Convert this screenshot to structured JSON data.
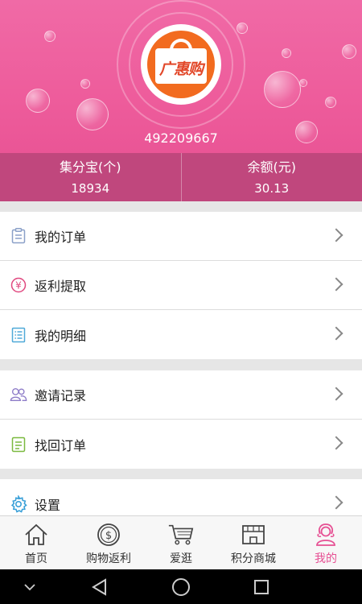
{
  "header": {
    "logo_text": "广惠购",
    "user_id": "492209667"
  },
  "stats": [
    {
      "label": "集分宝(个)",
      "value": "18934"
    },
    {
      "label": "余额(元)",
      "value": "30.13"
    }
  ],
  "menu_groups": [
    [
      {
        "label": "我的订单",
        "icon": "clipboard-icon"
      },
      {
        "label": "返利提取",
        "icon": "yen-icon"
      },
      {
        "label": "我的明细",
        "icon": "list-icon"
      }
    ],
    [
      {
        "label": "邀请记录",
        "icon": "users-icon"
      },
      {
        "label": "找回订单",
        "icon": "document-icon"
      }
    ],
    [
      {
        "label": "设置",
        "icon": "gear-icon"
      }
    ]
  ],
  "tabs": [
    {
      "label": "首页",
      "icon": "home-icon"
    },
    {
      "label": "购物返利",
      "icon": "dollar-coin-icon"
    },
    {
      "label": "爱逛",
      "icon": "cart-icon"
    },
    {
      "label": "积分商城",
      "icon": "store-icon"
    },
    {
      "label": "我的",
      "icon": "user-icon",
      "active": true
    }
  ],
  "colors": {
    "brand_pink": "#ee5d9c",
    "stats_bg": "#c0477d",
    "active_tab": "#e64f93",
    "logo_orange": "#f26b1f"
  }
}
